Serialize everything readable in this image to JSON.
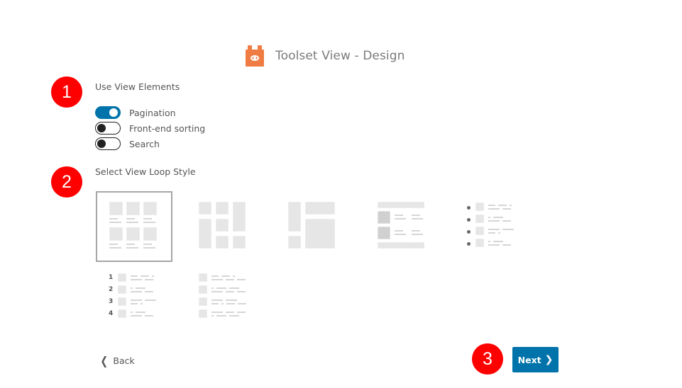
{
  "header": {
    "title": "Toolset View - Design",
    "logo_icon": "toolset-eye-logo-icon",
    "logo_color": "#ef7d43"
  },
  "steps": [
    {
      "number": "1",
      "color": "#ff0000"
    },
    {
      "number": "2",
      "color": "#ff0000"
    },
    {
      "number": "3",
      "color": "#ff0000"
    }
  ],
  "view_elements": {
    "label": "Use View Elements",
    "toggles": [
      {
        "label": "Pagination",
        "on": true
      },
      {
        "label": "Front-end sorting",
        "on": false
      },
      {
        "label": "Search",
        "on": false
      }
    ],
    "toggle_on_color": "#0073aa"
  },
  "loop_style": {
    "label": "Select View Loop Style",
    "options": [
      {
        "name": "grid",
        "selected": true
      },
      {
        "name": "masonry",
        "selected": false
      },
      {
        "name": "bootstrap-grid",
        "selected": false
      },
      {
        "name": "table",
        "selected": false
      },
      {
        "name": "unordered-list",
        "selected": false
      },
      {
        "name": "ordered-list",
        "numbers": [
          "1",
          "2",
          "3",
          "4"
        ],
        "selected": false
      },
      {
        "name": "unformatted-list",
        "selected": false
      }
    ]
  },
  "footer": {
    "back_label": "Back",
    "back_icon": "chevron-left-icon",
    "next_label": "Next",
    "next_icon": "chevron-right-icon",
    "next_color": "#0073aa"
  }
}
